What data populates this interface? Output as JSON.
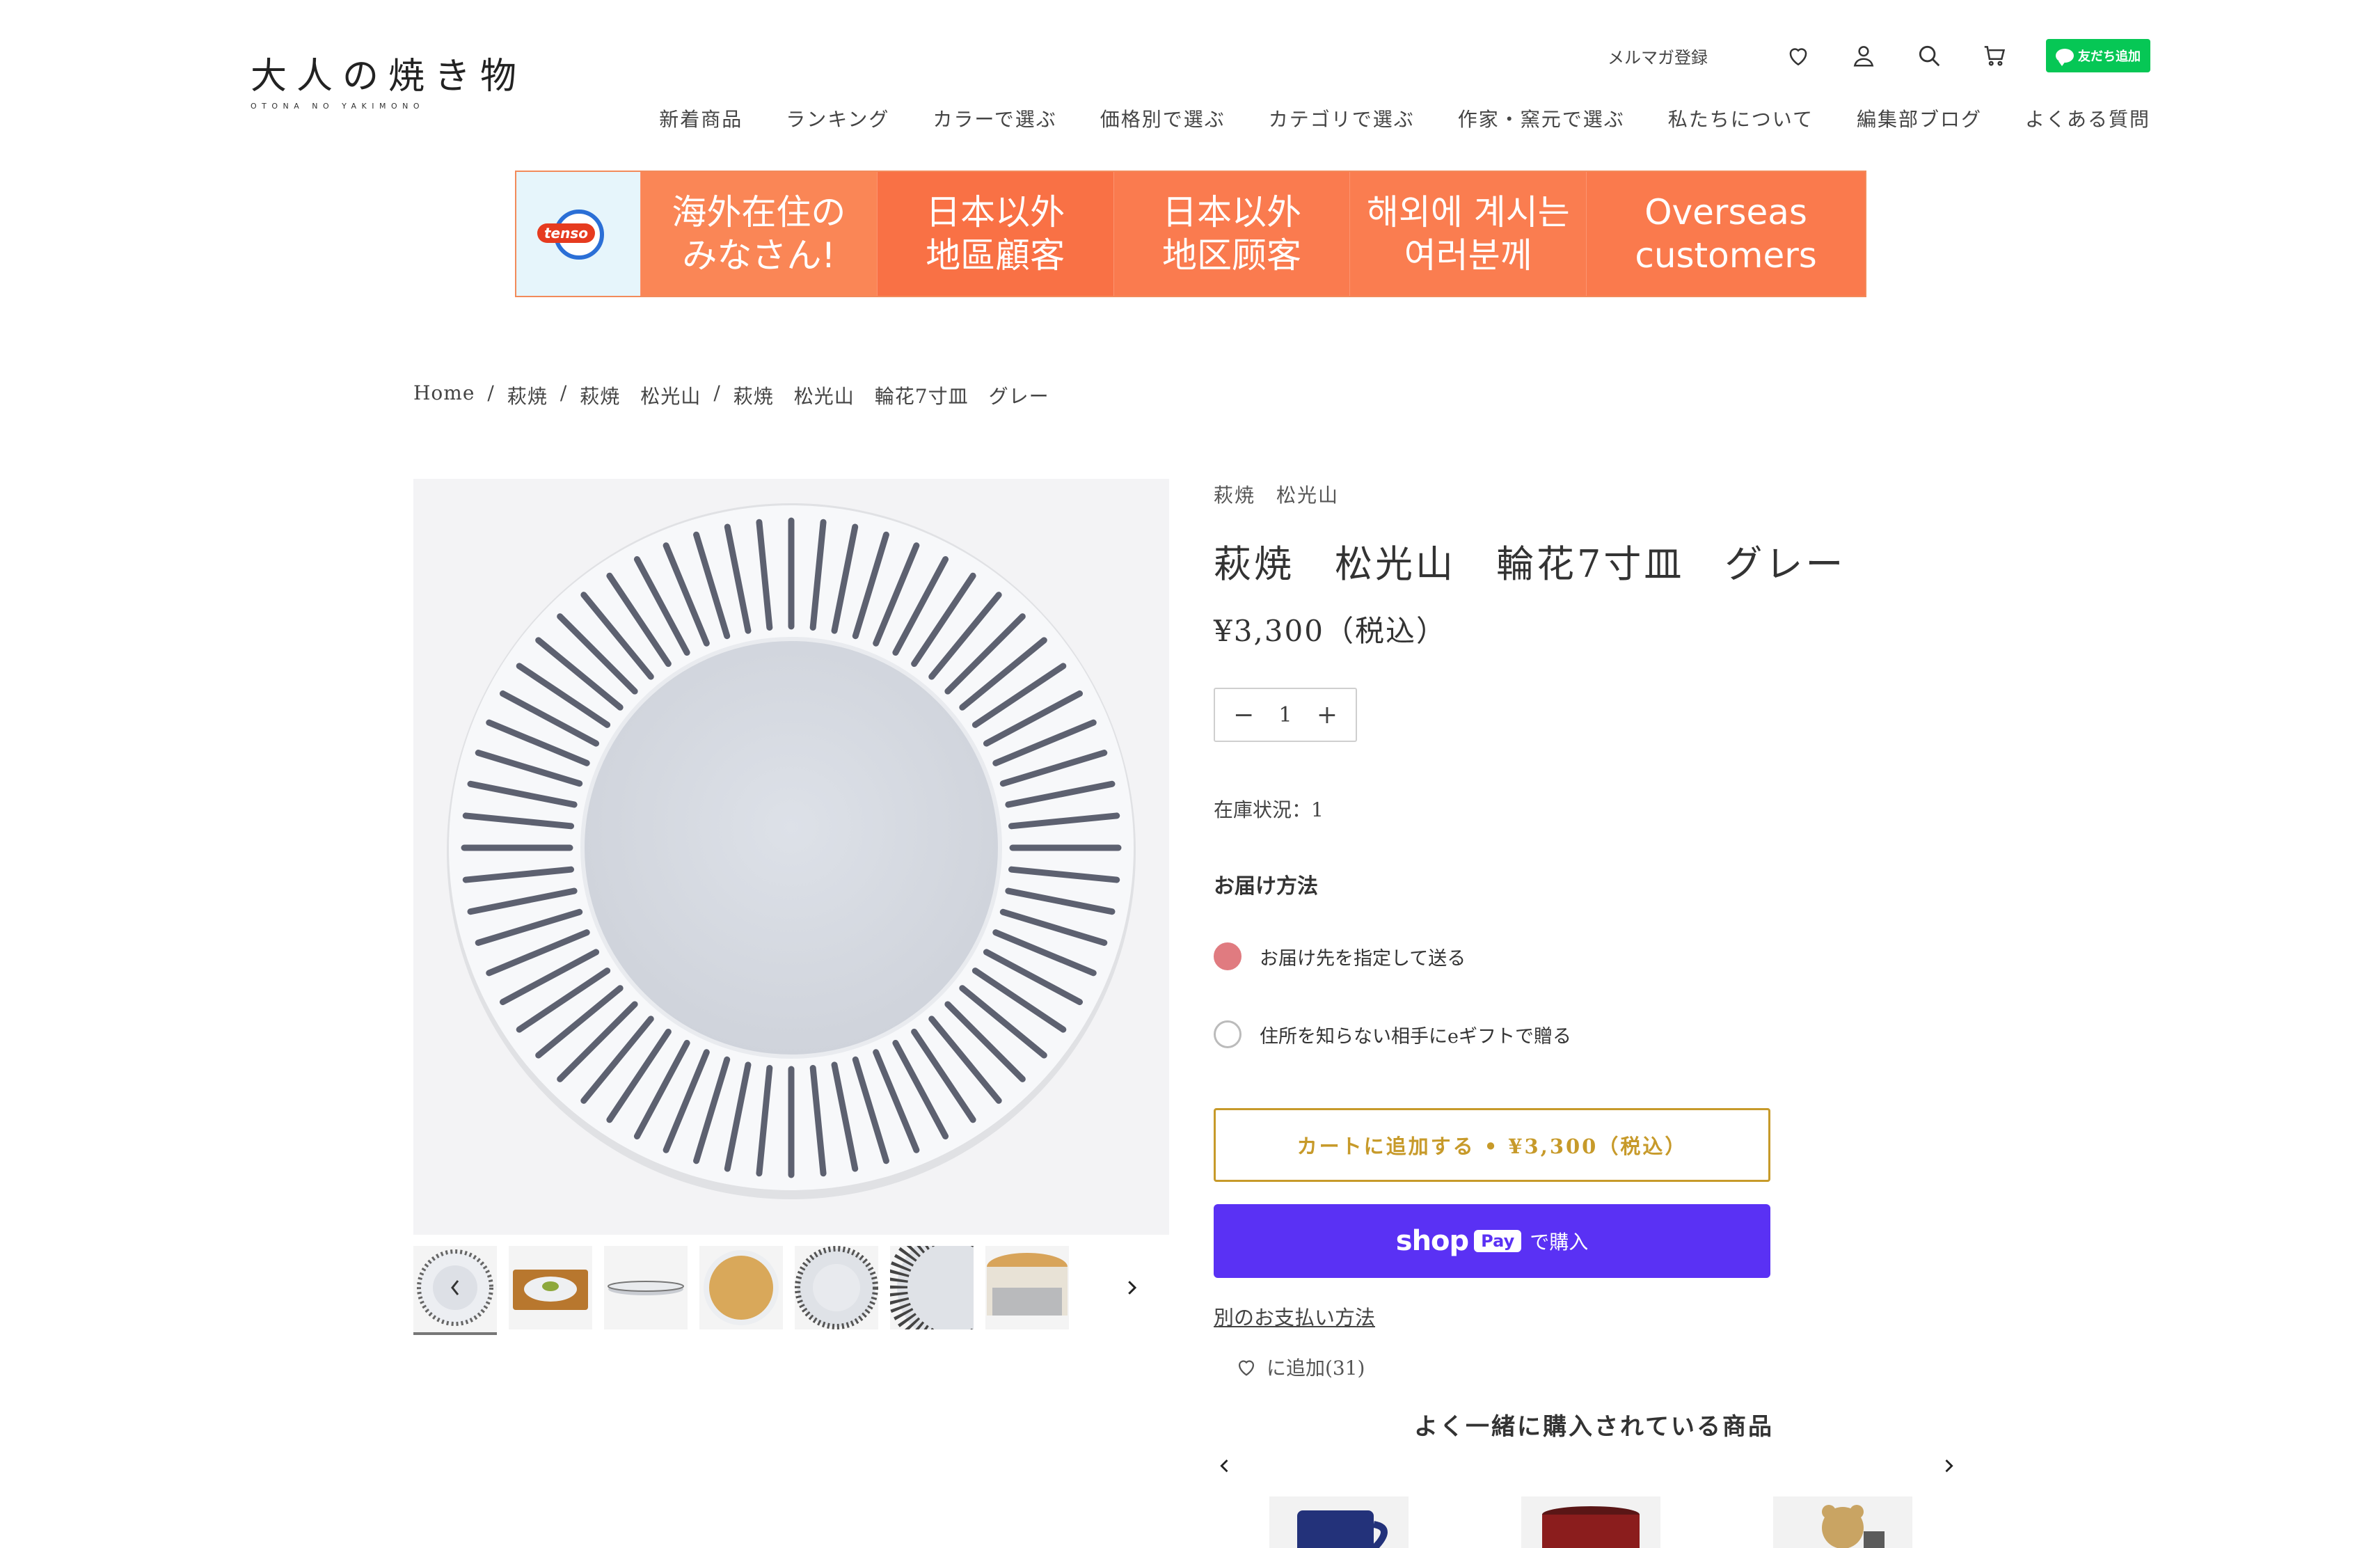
{
  "header": {
    "logo_main": "大人の焼き物",
    "logo_sub": "OTONA NO YAKIMONO",
    "newsletter_label": "メルマガ登録",
    "line_button_label": "友だち追加",
    "icons": [
      "heart-icon",
      "account-icon",
      "search-icon",
      "cart-icon"
    ]
  },
  "nav": {
    "items": [
      "新着商品",
      "ランキング",
      "カラーで選ぶ",
      "価格別で選ぶ",
      "カテゴリで選ぶ",
      "作家・窯元で選ぶ",
      "私たちについて",
      "編集部ブログ",
      "よくある質問"
    ]
  },
  "banner": {
    "logo_text": "tenso",
    "cells": [
      "海外在住の\nみなさん!",
      "日本以外\n地區顧客",
      "日本以外\n地区顾客",
      "해외에 계시는\n여러분께",
      "Overseas\ncustomers"
    ]
  },
  "breadcrumb": {
    "items": [
      "Home",
      "萩焼",
      "萩焼　松光山",
      "萩焼　松光山　輪花7寸皿　グレー"
    ]
  },
  "product": {
    "vendor": "萩焼　松光山",
    "title": "萩焼　松光山　輪花7寸皿　グレー",
    "price": "¥3,300（税込）",
    "quantity": "1",
    "stock": "在庫状況：1",
    "delivery_title": "お届け方法",
    "delivery_options": [
      "お届け先を指定して送る",
      "住所を知らない相手にeギフトで贈る"
    ],
    "delivery_selected": 0,
    "add_to_cart": "カートに追加する • ¥3,300（税込）",
    "shop_pay_word": "shop",
    "shop_pay_badge": "Pay",
    "shop_pay_suffix": "で購入",
    "other_payment": "別のお支払い方法",
    "wishlist": "に追加(31)"
  },
  "related": {
    "title": "よく一緒に購入されている商品"
  },
  "colors": {
    "accent_gold": "#c79a2a",
    "shop_pay": "#5a31f4",
    "radio_selected": "#e07b80",
    "banner_orange": "#f97a4e",
    "line_green": "#06c755"
  }
}
